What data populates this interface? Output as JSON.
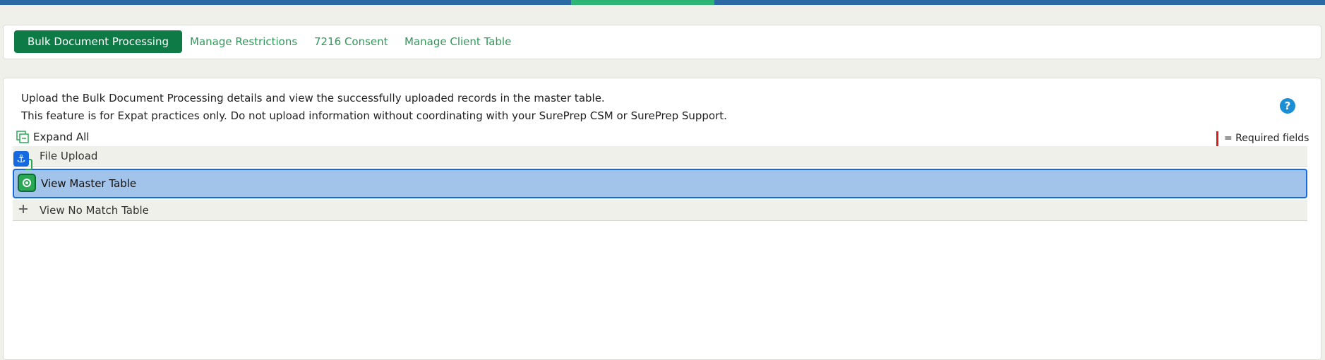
{
  "colors": {
    "top_bar": "#2b6aa3",
    "top_bar_accent": "#2bb673",
    "tab_active_bg": "#0e7a45",
    "tab_link": "#2e9a59",
    "selected_row": "#a3c4ea",
    "selected_border": "#1769e0",
    "required_marker": "#e01b1b",
    "help_icon": "#1b8fd6"
  },
  "tabs": [
    {
      "label": "Bulk Document Processing",
      "active": true
    },
    {
      "label": "Manage Restrictions",
      "active": false
    },
    {
      "label": "7216 Consent",
      "active": false
    },
    {
      "label": "Manage Client Table",
      "active": false
    }
  ],
  "description": {
    "line1": "Upload the Bulk Document Processing details and view the successfully uploaded records in the master table.",
    "line2": "This feature is for Expat practices only. Do not upload information without coordinating with your SurePrep CSM or SurePrep Support."
  },
  "help_icon": {
    "glyph": "?",
    "icon": "help-icon"
  },
  "expand_all_label": "Expand All",
  "required_legend": "= Required fields",
  "sections": [
    {
      "label": "File Upload",
      "icon": "expand-icon",
      "selected": false
    },
    {
      "label": "View Master Table",
      "icon": "expand-icon",
      "selected": true
    },
    {
      "label": "View No Match Table",
      "icon": "plus-icon",
      "selected": false
    }
  ],
  "overlay": {
    "anchor_glyph": "⚓"
  }
}
